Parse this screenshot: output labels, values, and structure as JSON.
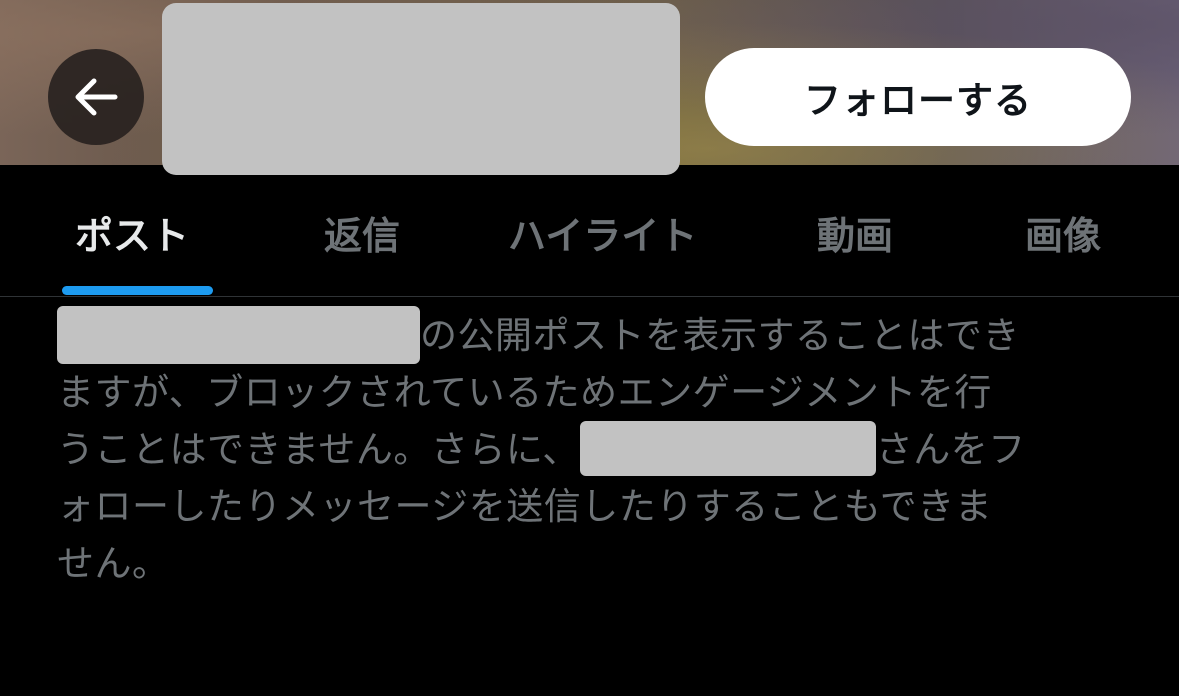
{
  "header": {
    "back_icon": "arrow-left-icon",
    "follow_label": "フォローする",
    "colors": {
      "follow_bg": "#ffffff",
      "follow_text": "#0f1419",
      "redaction": "#c2c2c2"
    }
  },
  "tabs": {
    "items": [
      {
        "label": "ポスト",
        "active": true
      },
      {
        "label": "返信",
        "active": false
      },
      {
        "label": "ハイライト",
        "active": false
      },
      {
        "label": "動画",
        "active": false
      },
      {
        "label": "画像",
        "active": false
      }
    ],
    "colors": {
      "active_text": "#e7e9ea",
      "inactive_text": "#6e7377",
      "indicator": "#1d9bf0"
    }
  },
  "message": {
    "line1_after_redaction": "の公開ポストを表示することはでき",
    "line2": "ますが、ブロックされているためエンゲージメントを行",
    "line3_before_redaction": "うことはできません。さらに、",
    "line3_after_redaction": "さんをフ",
    "line4": "ォローしたりメッセージを送信したりすることもできま",
    "line5": "せん。",
    "color": "#6e7377"
  }
}
